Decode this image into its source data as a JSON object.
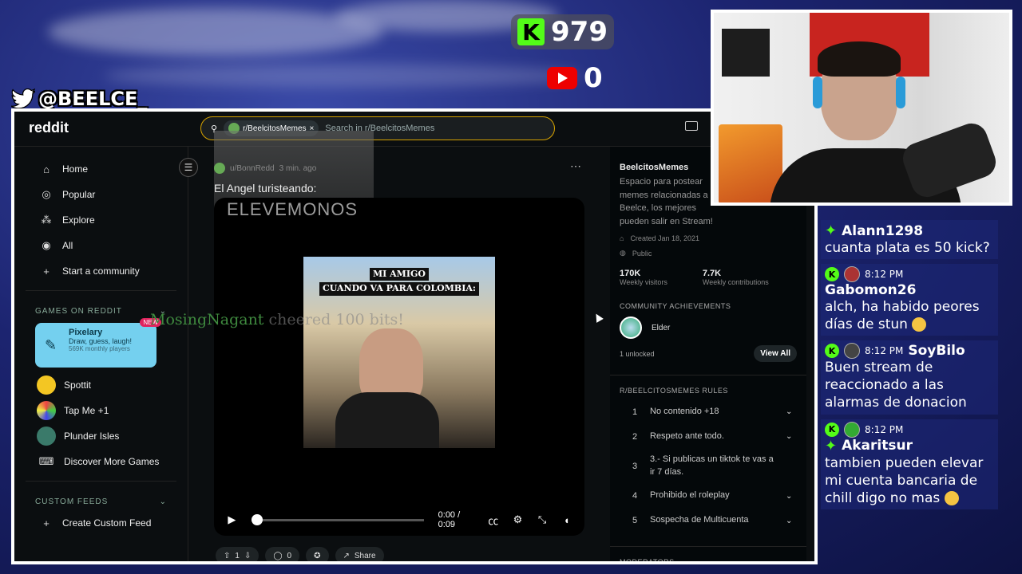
{
  "overlay": {
    "kick_count": "979",
    "youtube_count": "0",
    "twitter_handle": "@BEELCE_",
    "kick_logo": "K"
  },
  "browser": {
    "logo": "reddit",
    "search": {
      "chip": "r/BeelcitosMemes",
      "chip_close": "×",
      "placeholder": "Search in r/BeelcitosMemes"
    }
  },
  "sidebar": {
    "nav": [
      {
        "label": "Home",
        "icon": "home-icon"
      },
      {
        "label": "Popular",
        "icon": "popular-icon"
      },
      {
        "label": "Explore",
        "icon": "explore-icon"
      },
      {
        "label": "All",
        "icon": "all-icon"
      },
      {
        "label": "Start a community",
        "icon": "plus-icon"
      }
    ],
    "games_header": "GAMES ON REDDIT",
    "pixelary": {
      "title": "Pixelary",
      "subtitle": "Draw, guess, laugh!",
      "players": "569K monthly players",
      "badge": "NEW"
    },
    "games": [
      "Spottit",
      "Tap Me +1",
      "Plunder Isles",
      "Discover More Games"
    ],
    "custom_feeds_header": "CUSTOM FEEDS",
    "create_feed": "Create Custom Feed"
  },
  "post": {
    "author": "u/BonnRedd",
    "age": "3 min. ago",
    "title": "El Angel turisteando:",
    "overlay_text": "ELEVEMONOS",
    "caption_line1": "MI AMIGO",
    "caption_line2": "CUANDO VA PARA COLOMBIA:",
    "time": "0:00 / 0:09",
    "progress": 0,
    "votes": "1",
    "comments": "0",
    "share": "Share",
    "cheer_user": "MosingNagant",
    "cheer_rest": " cheered 100 bits!"
  },
  "community": {
    "name": "BeelcitosMemes",
    "description": "Espacio para postear memes relacionadas a Beelce, los mejores pueden salir en Stream!",
    "created": "Created Jan 18, 2021",
    "visibility": "Public",
    "weekly_visitors": "170K",
    "weekly_visitors_label": "Weekly visitors",
    "weekly_contributions": "7.7K",
    "weekly_contributions_label": "Weekly contributions",
    "achievements_header": "COMMUNITY ACHIEVEMENTS",
    "achievement": "Elder",
    "unlocked": "1 unlocked",
    "view_all": "View All",
    "rules_header": "R/BEELCITOSMEMES RULES",
    "rules": [
      {
        "n": "1",
        "text": "No contenido +18"
      },
      {
        "n": "2",
        "text": "Respeto ante todo."
      },
      {
        "n": "3",
        "text": "3.- Si publicas un tiktok te vas a ir 7 días."
      },
      {
        "n": "4",
        "text": "Prohibido el roleplay"
      },
      {
        "n": "5",
        "text": "Sospecha de Multicuenta"
      }
    ],
    "moderators_header": "MODERATORS"
  },
  "chat": [
    {
      "time": "",
      "user": "Alann1298",
      "text": "cuanta plata es 50 kick?"
    },
    {
      "time": "8:12 PM",
      "user": "Gabomon26",
      "text": "alch, ha habido peores días de stun"
    },
    {
      "time": "8:12 PM",
      "user": "SoyBilo",
      "text": "Buen stream de reaccionado a las alarmas de donacion"
    },
    {
      "time": "8:12 PM",
      "user": "Akaritsur",
      "text": "tambien pueden elevar mi cuenta bancaria de chill digo no mas"
    }
  ]
}
